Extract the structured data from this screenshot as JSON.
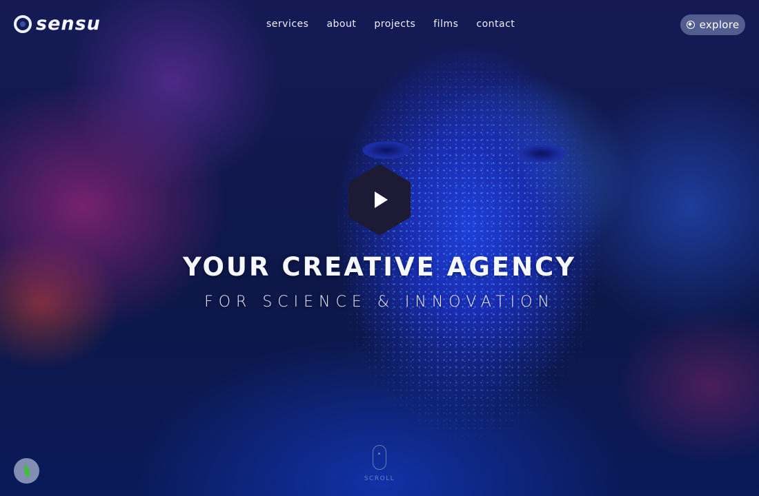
{
  "header": {
    "logo_text": "sensu",
    "nav": [
      "services",
      "about",
      "projects",
      "films",
      "contact"
    ],
    "explore_label": "explore"
  },
  "hero": {
    "headline": "YOUR CREATIVE AGENCY",
    "subline": "FOR SCIENCE & INNOVATION",
    "scroll_label": "SCROLL"
  },
  "icons": {
    "logo": "ring-logo-icon",
    "explore": "compass-icon",
    "play": "play-icon",
    "scroll": "mouse-icon",
    "leaf": "leaf-icon"
  },
  "colors": {
    "play_hex": "#1c1a34",
    "leaf": "#46b84a",
    "text": "#ffffff"
  }
}
